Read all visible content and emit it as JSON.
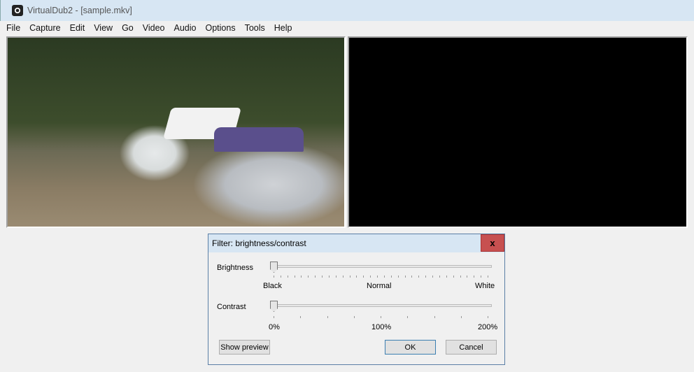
{
  "window": {
    "title": "VirtualDub2  - [sample.mkv]"
  },
  "menu": [
    "File",
    "Capture",
    "Edit",
    "View",
    "Go",
    "Video",
    "Audio",
    "Options",
    "Tools",
    "Help"
  ],
  "dialog": {
    "title": "Filter: brightness/contrast",
    "close": "x",
    "brightness": {
      "label": "Brightness",
      "min": "Black",
      "mid": "Normal",
      "max": "White",
      "value_fraction": 0
    },
    "contrast": {
      "label": "Contrast",
      "min": "0%",
      "mid": "100%",
      "max": "200%",
      "value_fraction": 0
    },
    "show_preview": "Show preview",
    "ok": "OK",
    "cancel": "Cancel"
  }
}
